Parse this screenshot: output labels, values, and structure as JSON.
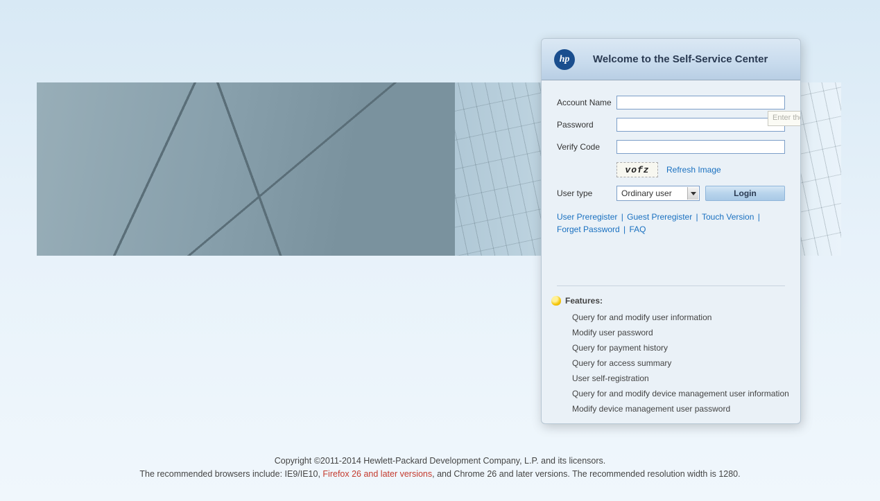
{
  "panel": {
    "title": "Welcome to the Self-Service Center",
    "logo_text": "hp"
  },
  "form": {
    "account_label": "Account Name",
    "account_value": "",
    "password_label": "Password",
    "password_value": "",
    "verify_label": "Verify Code",
    "verify_value": "",
    "captcha_text": "vofz",
    "refresh_label": "Refresh Image",
    "usertype_label": "User type",
    "usertype_selected": "Ordinary user",
    "login_label": "Login",
    "tooltip": "Enter the account name"
  },
  "links": {
    "user_prereg": "User Preregister",
    "guest_prereg": "Guest Preregister",
    "touch": "Touch Version",
    "forget": "Forget Password",
    "faq": "FAQ"
  },
  "features": {
    "title": "Features:",
    "items": [
      "Query for and modify user information",
      "Modify user password",
      "Query for payment history",
      "Query for access summary",
      "User self-registration",
      "Query for and modify device management user information",
      "Modify device management user password"
    ]
  },
  "footer": {
    "line1": "Copyright ©2011-2014 Hewlett-Packard Development Company, L.P. and its licensors.",
    "line2_a": "The recommended browsers include: IE9/IE10, ",
    "line2_b": "Firefox 26 and later versions",
    "line2_c": ", and Chrome 26 and later versions. The recommended resolution width is 1280."
  }
}
